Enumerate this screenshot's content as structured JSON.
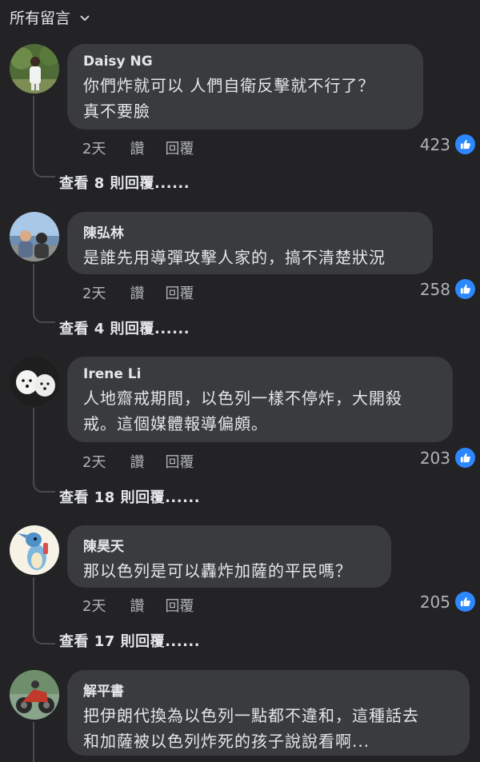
{
  "header": {
    "title": "所有留言"
  },
  "comments": [
    {
      "author": "Daisy NG",
      "text": "你們炸就可以 人們自衛反擊就不行了？\n真不要臉",
      "time": "2天",
      "like_label": "讚",
      "reply_label": "回覆",
      "likes": "423",
      "view_replies": "查看 8 則回覆......"
    },
    {
      "author": "陳弘林",
      "text": "是誰先用導彈攻擊人家的，搞不清楚狀況",
      "time": "2天",
      "like_label": "讚",
      "reply_label": "回覆",
      "likes": "258",
      "view_replies": "查看 4 則回覆......"
    },
    {
      "author": "Irene Li",
      "text": "人地齋戒期間，以色列一樣不停炸，大開殺\n戒。這個媒體報導偏頗。",
      "time": "2天",
      "like_label": "讚",
      "reply_label": "回覆",
      "likes": "203",
      "view_replies": "查看 18 則回覆......"
    },
    {
      "author": "陳昊天",
      "text": "那以色列是可以轟炸加薩的平民嗎？",
      "time": "2天",
      "like_label": "讚",
      "reply_label": "回覆",
      "likes": "205",
      "view_replies": "查看 17 則回覆......"
    },
    {
      "author": "解平書",
      "text": "把伊朗代換為以色列一點都不違和，這種話去\n和加薩被以色列炸死的孩子說說看啊...",
      "time": "",
      "like_label": "",
      "reply_label": "",
      "likes": "",
      "view_replies": ""
    }
  ],
  "colors": {
    "accent": "#2d88ff",
    "bubble": "#3a3b3c",
    "background": "#232325"
  }
}
